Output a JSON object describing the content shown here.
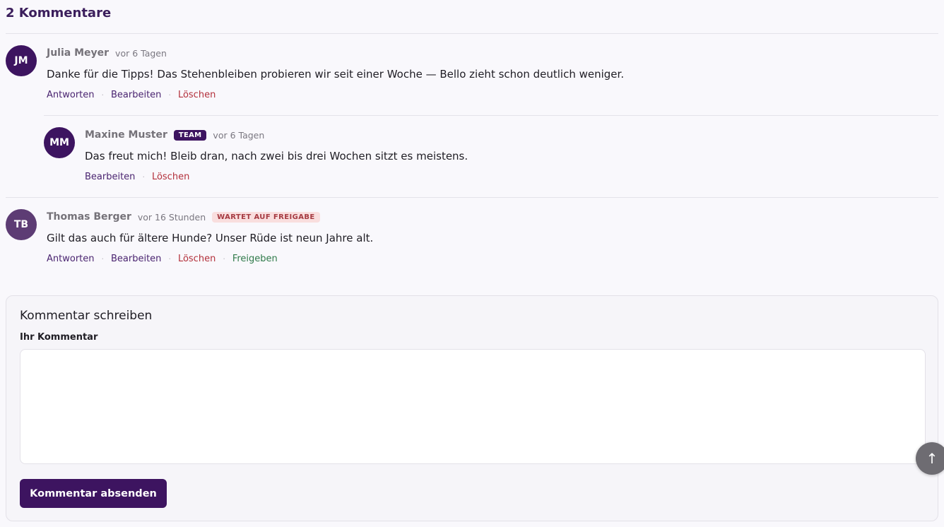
{
  "comments_section": {
    "title": "2 Kommentare",
    "comments": [
      {
        "initials": "JM",
        "author": "Julia Meyer",
        "time": "vor 6 Tagen",
        "text": "Danke für die Tipps! Das Stehenbleiben probieren wir seit einer Woche — Bello zieht schon deutlich weniger.",
        "actions": [
          "Antworten",
          "Bearbeiten",
          "Löschen"
        ]
      },
      {
        "initials": "MM",
        "author": "Maxine Muster",
        "badge": "TEAM",
        "time": "vor 6 Tagen",
        "text": "Das freut mich! Bleib dran, nach zwei bis drei Wochen sitzt es meistens.",
        "actions": [
          "Bearbeiten",
          "Löschen"
        ]
      },
      {
        "initials": "TB",
        "author": "Thomas Berger",
        "time": "vor 16 Stunden",
        "badge": "WARTET AUF FREIGABE",
        "text": "Gilt das auch für ältere Hunde? Unser Rüde ist neun Jahre alt.",
        "actions": [
          "Antworten",
          "Bearbeiten",
          "Löschen",
          "Freigeben"
        ]
      }
    ]
  },
  "comment_form": {
    "title": "Kommentar schreiben",
    "label": "Ihr Kommentar",
    "value": "",
    "submit_label": "Kommentar absenden"
  },
  "icons": {
    "scroll_top": "arrow-up-icon",
    "scroll_top_glyph": "↑"
  },
  "colors": {
    "brand": "#3d1460",
    "danger": "#b3303b",
    "success": "#2f7a4a"
  }
}
